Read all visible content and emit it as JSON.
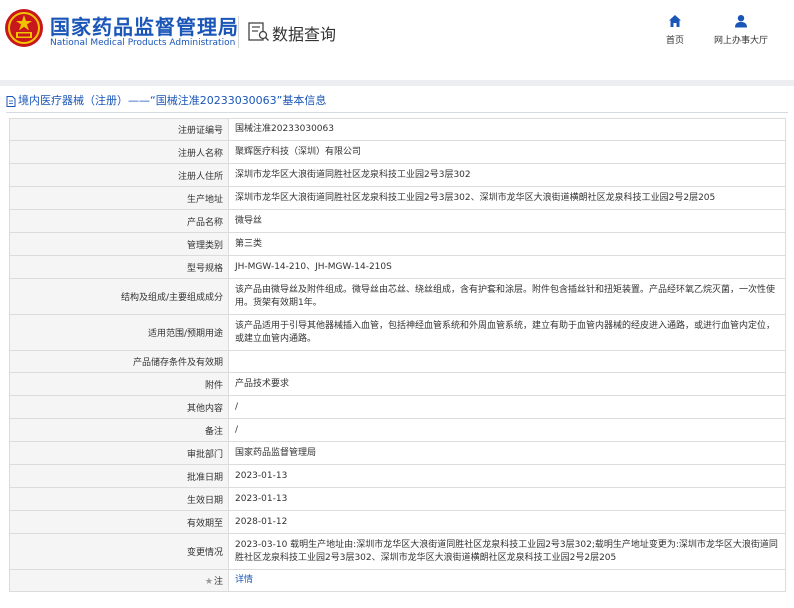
{
  "header": {
    "brand_cn": "国家药品监督管理局",
    "brand_en": "National Medical Products Administration",
    "section_title": "数据查询",
    "nav": {
      "home": "首页",
      "office": "网上办事大厅"
    }
  },
  "breadcrumb": "境内医疗器械（注册）——“国械注准20233030063”基本信息",
  "fields": [
    {
      "label": "注册证编号",
      "value": "国械注准20233030063"
    },
    {
      "label": "注册人名称",
      "value": "聚辉医疗科技（深圳）有限公司"
    },
    {
      "label": "注册人住所",
      "value": "深圳市龙华区大浪街道同胜社区龙泉科技工业园2号3层302"
    },
    {
      "label": "生产地址",
      "value": "深圳市龙华区大浪街道同胜社区龙泉科技工业园2号3层302、深圳市龙华区大浪街道横朗社区龙泉科技工业园2号2层205"
    },
    {
      "label": "产品名称",
      "value": "微导丝"
    },
    {
      "label": "管理类别",
      "value": "第三类"
    },
    {
      "label": "型号规格",
      "value": "JH-MGW-14-210、JH-MGW-14-210S"
    },
    {
      "label": "结构及组成/主要组成成分",
      "value": "该产品由微导丝及附件组成。微导丝由芯丝、绕丝组成，含有护套和涂层。附件包含插丝针和扭矩装置。产品经环氧乙烷灭菌，一次性使用。货架有效期1年。"
    },
    {
      "label": "适用范围/预期用途",
      "value": "该产品适用于引导其他器械插入血管，包括神经血管系统和外周血管系统，建立有助于血管内器械的经皮进入通路，或进行血管内定位，或建立血管内通路。"
    },
    {
      "label": "产品储存条件及有效期",
      "value": ""
    },
    {
      "label": "附件",
      "value": "产品技术要求"
    },
    {
      "label": "其他内容",
      "value": "/"
    },
    {
      "label": "备注",
      "value": "/"
    },
    {
      "label": "审批部门",
      "value": "国家药品监督管理局"
    },
    {
      "label": "批准日期",
      "value": "2023-01-13"
    },
    {
      "label": "生效日期",
      "value": "2023-01-13"
    },
    {
      "label": "有效期至",
      "value": "2028-01-12"
    },
    {
      "label": "变更情况",
      "value": "2023-03-10 载明生产地址由:深圳市龙华区大浪街道同胜社区龙泉科技工业园2号3层302;载明生产地址变更为:深圳市龙华区大浪街道同胜社区龙泉科技工业园2号3层302、深圳市龙华区大浪街道横朗社区龙泉科技工业园2号2层205"
    },
    {
      "label": "注",
      "value": "详情"
    }
  ],
  "colors": {
    "brand_blue": "#1a56b8",
    "label_bg": "#f5f5f5",
    "border": "#dcdcdc"
  }
}
